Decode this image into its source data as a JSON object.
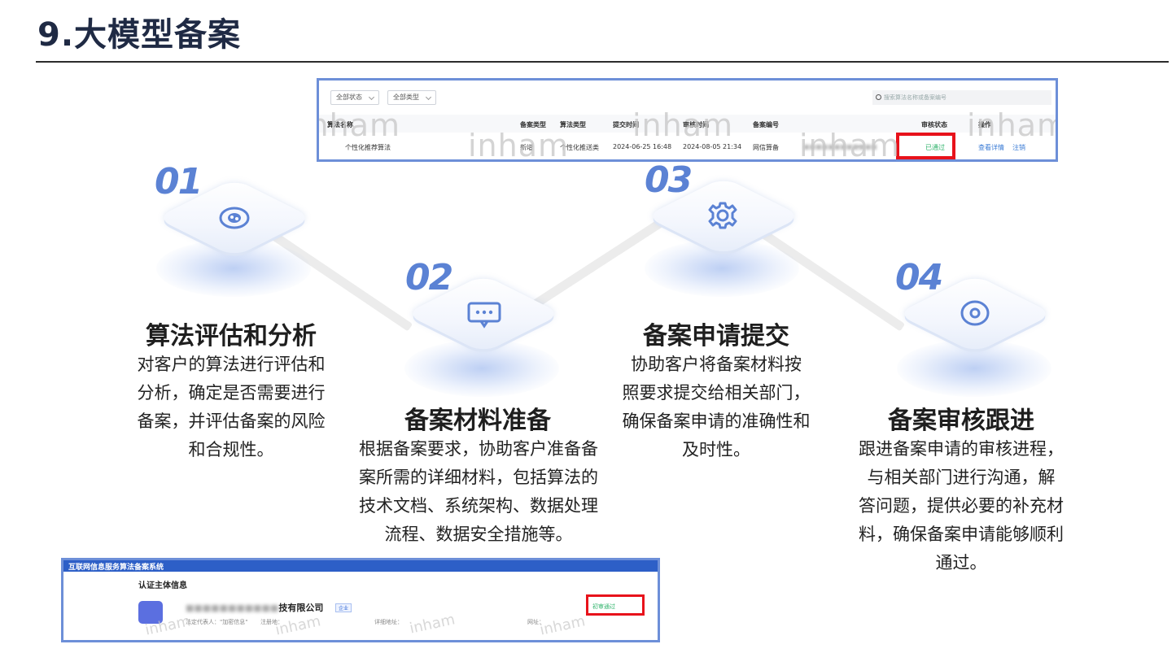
{
  "slide": {
    "title": "9.大模型备案"
  },
  "top_screenshot": {
    "filters": [
      "全部状态",
      "全部类型"
    ],
    "search_placeholder": "搜索算法名称或备案编号",
    "columns": [
      "算法名称",
      "备案类型",
      "算法类型",
      "提交时间",
      "审核时间",
      "备案编号",
      "审核状态",
      "操作"
    ],
    "row": {
      "name": "个性化推荐算法",
      "type": "新增",
      "algo_type": "个性化推送类",
      "submit_time": "2024-06-25 16:48",
      "review_time": "2024-08-05 21:34",
      "record_no": "网信算备",
      "status": "已通过",
      "action_view": "查看详情",
      "action_cancel": "注销"
    },
    "watermark": "inham"
  },
  "steps": [
    {
      "num": "01",
      "icon": "eye-icon",
      "title": "算法评估和分析",
      "lines": [
        "对客户的算法进行评估和",
        "分析，确定是否需要进行",
        "备案，并评估备案的风险",
        "和合规性。"
      ]
    },
    {
      "num": "02",
      "icon": "chat-bubble-icon",
      "title": "备案材料准备",
      "lines": [
        "根据备案要求，协助客户准备备",
        "案所需的详细材料，包括算法的",
        "技术文档、系统架构、数据处理",
        "流程、数据安全措施等。"
      ]
    },
    {
      "num": "03",
      "icon": "gear-icon",
      "title": "备案申请提交",
      "lines": [
        "协助客户将备案材料按",
        "照要求提交给相关部门，",
        "确保备案申请的准确性和",
        "及时性。"
      ]
    },
    {
      "num": "04",
      "icon": "target-icon",
      "title": "备案审核跟进",
      "lines": [
        "跟进备案申请的审核进程，",
        "与相关部门进行沟通，解",
        "答问题，提供必要的补充材",
        "料，确保备案申请能够顺利",
        "通过。"
      ]
    }
  ],
  "bottom_screenshot": {
    "system_title": "互联网信息服务算法备案系统",
    "section_title": "认证主体信息",
    "company_suffix": "技有限公司",
    "badge": "企业",
    "meta_rep": "法定代表人：\"加密信息\"",
    "meta_reg": "注册地：",
    "meta_addr": "详细地址：",
    "meta_site": "网址：",
    "status": "初审通过",
    "watermark": "inham"
  },
  "colors": {
    "accent": "#5b82d4",
    "highlight_box": "#e8121b",
    "status_ok": "#2fb36b",
    "screenshot_border": "#6d8fd8"
  }
}
